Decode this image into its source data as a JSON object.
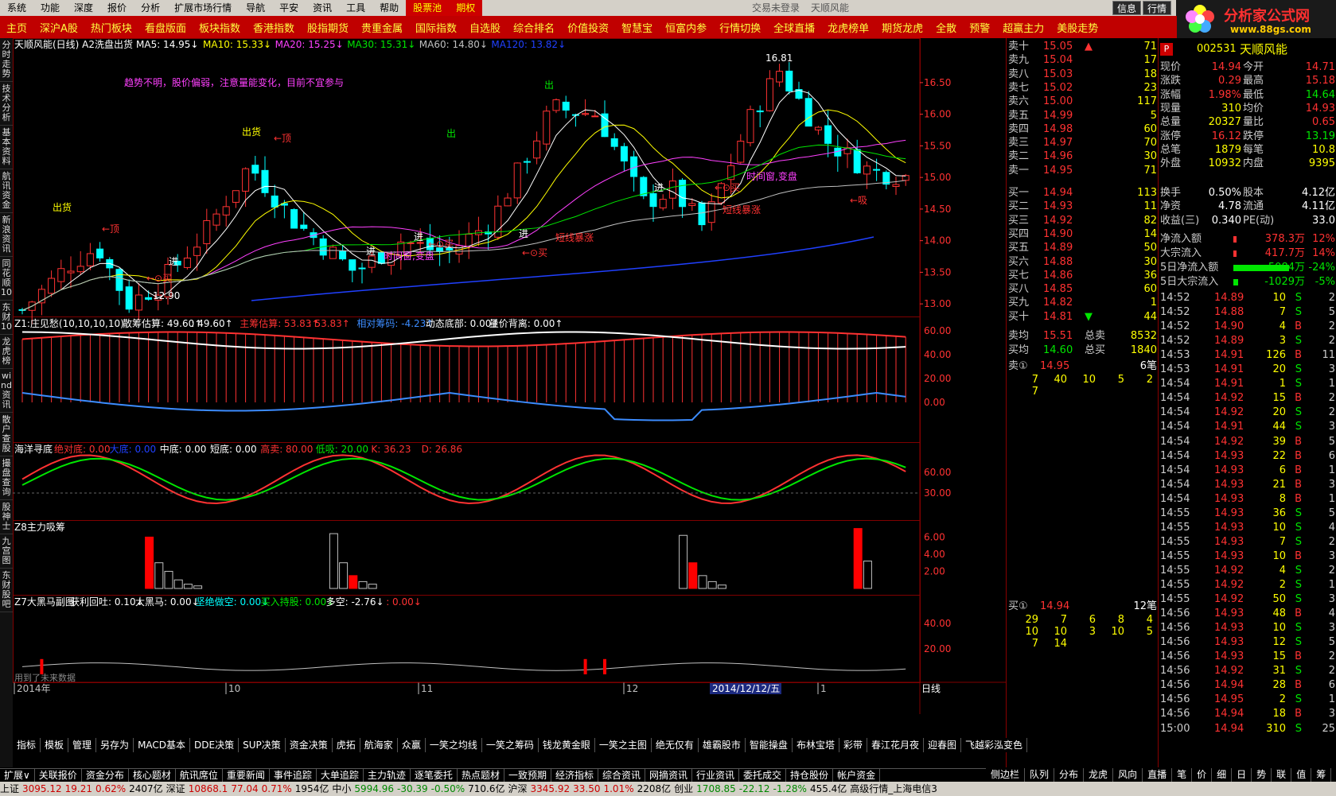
{
  "menu": {
    "items": [
      "系统",
      "功能",
      "深度",
      "报价",
      "分析",
      "扩展市场行情",
      "导航",
      "平安",
      "资讯",
      "工具",
      "帮助"
    ],
    "red_items": [
      "股票池",
      "期权"
    ],
    "center_text": "交易未登录",
    "center_name": "天顺风能",
    "right_buttons": [
      "信息",
      "行情"
    ]
  },
  "logo": {
    "title": "分析家公式网",
    "url": "www.88gs.com"
  },
  "toolbar": [
    "主页",
    "深沪A股",
    "热门板块",
    "看盘版面",
    "板块指数",
    "香港指数",
    "股指期货",
    "贵重金属",
    "国际指数",
    "自选股",
    "综合排名",
    "价值投资",
    "智慧宝",
    "恒富内参",
    "行情切换",
    "全球直播",
    "龙虎榜单",
    "期货龙虎",
    "全散",
    "预警",
    "超赢主力",
    "美股走势"
  ],
  "vtabs": [
    "分时走势",
    "技术分析",
    "基本资料",
    "航讯资金",
    "新浪资讯",
    "同花顺10",
    "东财10",
    "龙虎榜",
    "wind资讯",
    "散户查股",
    "撮盘查询",
    "股神士",
    "九宫图",
    "东财股吧"
  ],
  "main": {
    "title": "天顺风能(日线) A2洗盘出货",
    "ma": [
      {
        "label": "MA5: 14.95",
        "color": "#ffffff"
      },
      {
        "label": "MA10: 15.33",
        "color": "#ffff00"
      },
      {
        "label": "MA20: 15.25",
        "color": "#ff40ff"
      },
      {
        "label": "MA30: 15.31",
        "color": "#00e600"
      },
      {
        "label": "MA60: 14.80",
        "color": "#c0c0c0"
      },
      {
        "label": "MA120: 13.82",
        "color": "#2040ff"
      }
    ],
    "notice": "趋势不明，股价偏弱，注意量能变化，目前不宜参与",
    "high_label": "16.81",
    "low_label": "12.90",
    "annotations": [
      "出货",
      "←顶",
      "出货",
      "←顶",
      "出",
      "出",
      "←⊙买",
      "←⊙买",
      "←⊙买",
      "←⊙买",
      "进",
      "进",
      "进",
      "进",
      "进",
      "短线暴涨",
      "短线暴涨",
      "时间窗,变盘",
      "时间窗,变盘",
      "←吸"
    ],
    "axis": [
      "16.50",
      "16.00",
      "15.50",
      "15.00",
      "14.50",
      "14.00",
      "13.50",
      "13.00"
    ]
  },
  "p1": {
    "title": "Z1:庄见愁(10,10,10,10)",
    "items": [
      {
        "t": "散筹估算: 49.60",
        "c": "#ffffff"
      },
      {
        "t": ": 49.60",
        "c": "#ffffff"
      },
      {
        "t": "主筹估算: 53.83",
        "c": "#ff3232"
      },
      {
        "t": ": 53.83",
        "c": "#ff3232"
      },
      {
        "t": "相对筹码: -4.23",
        "c": "#3c8cff"
      },
      {
        "t": "动态底部: 0.00",
        "c": "#ffffff"
      },
      {
        "t": "量价背离: 0.00",
        "c": "#ffffff"
      }
    ],
    "axis": [
      "60.00",
      "40.00",
      "20.00",
      "0.00"
    ]
  },
  "p2": {
    "title": "海洋寻底",
    "items": [
      {
        "t": "绝对底: 0.00",
        "c": "#ff3232"
      },
      {
        "t": "大底: 0.00",
        "c": "#2040ff"
      },
      {
        "t": "中底: 0.00",
        "c": "#ffffff"
      },
      {
        "t": "短底: 0.00",
        "c": "#ffffff"
      },
      {
        "t": "高卖: 80.00",
        "c": "#ff3232"
      },
      {
        "t": "低吸: 20.00",
        "c": "#00e600"
      },
      {
        "t": "K: 36.23",
        "c": "#ff3232"
      },
      {
        "t": "D: 26.86",
        "c": "#ff3232"
      }
    ],
    "axis": [
      "60.00",
      "30.00"
    ]
  },
  "p3": {
    "title": "Z8主力吸筹",
    "axis": [
      "6.00",
      "4.00",
      "2.00"
    ]
  },
  "p4": {
    "title": "Z7大黑马副图",
    "items": [
      {
        "t": "获利回吐: 0.10",
        "c": "#ffffff"
      },
      {
        "t": "大黑马: 0.00",
        "c": "#ffffff"
      },
      {
        "t": "坚绝做空: 0.00",
        "c": "#00ffff"
      },
      {
        "t": "买入持股: 0.00",
        "c": "#00e600"
      },
      {
        "t": "多空: -2.76",
        "c": "#ffffff"
      },
      {
        "t": ": 0.00",
        "c": "#ff3232"
      }
    ],
    "axis": [
      "40.00",
      "20.00"
    ],
    "bottom_note": "用到了未来数据"
  },
  "xaxis": {
    "labels": [
      "2014年",
      "10",
      "11",
      "12",
      "1"
    ],
    "highlight": "2014/12/12/五",
    "right": "日线"
  },
  "bottom_tabs": [
    "指标",
    "模板",
    "管理",
    "另存为",
    "MACD基本",
    "DDE决策",
    "SUP决策",
    "资金决策",
    "虎拓",
    "航海家",
    "众赢",
    "一笑之均线",
    "一笑之筹码",
    "钱龙黄金眼",
    "一笑之主图",
    "绝无仅有",
    "雄霸股市",
    "智能操盘",
    "布林宝塔",
    "彩带",
    "春江花月夜",
    "迎春图",
    "飞越彩泓变色"
  ],
  "nav_tabs": [
    "扩展∨",
    "关联报价",
    "资金分布",
    "核心题材",
    "航讯席位",
    "重要新闻",
    "事件追踪",
    "大单追踪",
    "主力轨迹",
    "逐笔委托",
    "热点题材",
    "一致预期",
    "经济指标",
    "综合资讯",
    "网摘资讯",
    "行业资讯",
    "委托成交",
    "持仓股份",
    "帐户资金"
  ],
  "right_tabs": [
    "侧边栏",
    "队列",
    "分布",
    "龙虎",
    "风向",
    "直播",
    "笔",
    "价",
    "细",
    "日",
    "势",
    "联",
    "值",
    "筹"
  ],
  "status": [
    {
      "t": "上证",
      "c": "#000"
    },
    {
      "t": "3095.12",
      "c": "#c00"
    },
    {
      "t": "19.21",
      "c": "#c00"
    },
    {
      "t": "0.62%",
      "c": "#c00"
    },
    {
      "t": "2407亿",
      "c": "#000"
    },
    {
      "t": "深证",
      "c": "#000"
    },
    {
      "t": "10868.1",
      "c": "#c00"
    },
    {
      "t": "77.04",
      "c": "#c00"
    },
    {
      "t": "0.71%",
      "c": "#c00"
    },
    {
      "t": "1954亿",
      "c": "#000"
    },
    {
      "t": "中小",
      "c": "#000"
    },
    {
      "t": "5994.96",
      "c": "#080"
    },
    {
      "t": "-30.39",
      "c": "#080"
    },
    {
      "t": "-0.50%",
      "c": "#080"
    },
    {
      "t": "710.6亿",
      "c": "#000"
    },
    {
      "t": "沪深",
      "c": "#000"
    },
    {
      "t": "3345.92",
      "c": "#c00"
    },
    {
      "t": "33.50",
      "c": "#c00"
    },
    {
      "t": "1.01%",
      "c": "#c00"
    },
    {
      "t": "2208亿",
      "c": "#000"
    },
    {
      "t": "创业",
      "c": "#000"
    },
    {
      "t": "1708.85",
      "c": "#080"
    },
    {
      "t": "-22.12",
      "c": "#080"
    },
    {
      "t": "-1.28%",
      "c": "#080"
    },
    {
      "t": "455.4亿",
      "c": "#000"
    },
    {
      "t": "高级行情_上海电信3",
      "c": "#000"
    }
  ],
  "orderbook": {
    "sells": [
      {
        "n": "卖十",
        "p": "15.05",
        "v": "71",
        "mark": "▲"
      },
      {
        "n": "卖九",
        "p": "15.04",
        "v": "17"
      },
      {
        "n": "卖八",
        "p": "15.03",
        "v": "18"
      },
      {
        "n": "卖七",
        "p": "15.02",
        "v": "23"
      },
      {
        "n": "卖六",
        "p": "15.00",
        "v": "117"
      },
      {
        "n": "卖五",
        "p": "14.99",
        "v": "5"
      },
      {
        "n": "卖四",
        "p": "14.98",
        "v": "60"
      },
      {
        "n": "卖三",
        "p": "14.97",
        "v": "70"
      },
      {
        "n": "卖二",
        "p": "14.96",
        "v": "30"
      },
      {
        "n": "卖一",
        "p": "14.95",
        "v": "71"
      }
    ],
    "buys": [
      {
        "n": "买一",
        "p": "14.94",
        "v": "113"
      },
      {
        "n": "买二",
        "p": "14.93",
        "v": "11"
      },
      {
        "n": "买三",
        "p": "14.92",
        "v": "82"
      },
      {
        "n": "买四",
        "p": "14.90",
        "v": "14"
      },
      {
        "n": "买五",
        "p": "14.89",
        "v": "50"
      },
      {
        "n": "买六",
        "p": "14.88",
        "v": "30"
      },
      {
        "n": "买七",
        "p": "14.86",
        "v": "36"
      },
      {
        "n": "买八",
        "p": "14.85",
        "v": "60"
      },
      {
        "n": "买九",
        "p": "14.82",
        "v": "1"
      },
      {
        "n": "买十",
        "p": "14.81",
        "v": "44",
        "mark": "▼"
      }
    ],
    "avg_sell": {
      "n": "卖均",
      "p": "15.51",
      "tn": "总卖",
      "tv": "8532"
    },
    "avg_buy": {
      "n": "买均",
      "p": "14.60",
      "tn": "总买",
      "tv": "1840"
    },
    "queue_sell": {
      "n": "卖①",
      "p": "14.95",
      "cnt": "6笔",
      "rows": [
        [
          "7",
          "40",
          "10",
          "5",
          "2"
        ],
        [
          "7"
        ]
      ]
    },
    "queue_buy": {
      "n": "买①",
      "p": "14.94",
      "cnt": "12笔",
      "rows": [
        [
          "29",
          "7",
          "6",
          "8",
          "4"
        ],
        [
          "10",
          "10",
          "3",
          "10",
          "5"
        ],
        [
          "7",
          "14"
        ]
      ]
    }
  },
  "quote": {
    "badge": "P",
    "code": "002531",
    "name": "天顺风能",
    "rows": [
      [
        "现价",
        "14.94",
        "今开",
        "14.71"
      ],
      [
        "涨跌",
        "0.29",
        "最高",
        "15.18"
      ],
      [
        "涨幅",
        "1.98%",
        "最低",
        "14.64"
      ],
      [
        "现量",
        "310",
        "均价",
        "14.93"
      ],
      [
        "总量",
        "20327",
        "量比",
        "0.65"
      ],
      [
        "涨停",
        "16.12",
        "跌停",
        "13.19"
      ],
      [
        "总笔",
        "1879",
        "每笔",
        "10.8"
      ],
      [
        "外盘",
        "10932",
        "内盘",
        "9395"
      ]
    ],
    "rows2": [
      [
        "换手",
        "0.50%",
        "股本",
        "4.12亿"
      ],
      [
        "净资",
        "4.78",
        "流通",
        "4.11亿"
      ],
      [
        "收益(三)",
        "0.340",
        "PE(动)",
        "33.0"
      ]
    ],
    "flows": [
      {
        "n": "净流入额",
        "v": "378.3万",
        "p": "12%"
      },
      {
        "n": "大宗流入",
        "v": "417.7万",
        "p": "14%"
      },
      {
        "n": "5日净流入额",
        "v": "-5084万",
        "p": "-24%"
      },
      {
        "n": "5日大宗流入",
        "v": "-1029万",
        "p": "-5%"
      }
    ]
  },
  "ticks": [
    [
      "14:52",
      "14.89",
      "10",
      "S",
      "2"
    ],
    [
      "14:52",
      "14.88",
      "7",
      "S",
      "5"
    ],
    [
      "14:52",
      "14.90",
      "4",
      "B",
      "2"
    ],
    [
      "14:52",
      "14.89",
      "3",
      "S",
      "2"
    ],
    [
      "14:53",
      "14.91",
      "126",
      "B",
      "11"
    ],
    [
      "14:53",
      "14.91",
      "20",
      "S",
      "3"
    ],
    [
      "14:54",
      "14.91",
      "1",
      "S",
      "1"
    ],
    [
      "14:54",
      "14.92",
      "15",
      "B",
      "2"
    ],
    [
      "14:54",
      "14.92",
      "20",
      "S",
      "2"
    ],
    [
      "14:54",
      "14.91",
      "44",
      "S",
      "3"
    ],
    [
      "14:54",
      "14.92",
      "39",
      "B",
      "5"
    ],
    [
      "14:54",
      "14.93",
      "22",
      "B",
      "6"
    ],
    [
      "14:54",
      "14.93",
      "6",
      "B",
      "1"
    ],
    [
      "14:54",
      "14.93",
      "21",
      "B",
      "3"
    ],
    [
      "14:54",
      "14.93",
      "8",
      "B",
      "1"
    ],
    [
      "14:55",
      "14.93",
      "36",
      "S",
      "5"
    ],
    [
      "14:55",
      "14.93",
      "10",
      "S",
      "4"
    ],
    [
      "14:55",
      "14.93",
      "7",
      "S",
      "2"
    ],
    [
      "14:55",
      "14.93",
      "10",
      "B",
      "3"
    ],
    [
      "14:55",
      "14.92",
      "4",
      "S",
      "2"
    ],
    [
      "14:55",
      "14.92",
      "2",
      "S",
      "1"
    ],
    [
      "14:55",
      "14.92",
      "50",
      "S",
      "3"
    ],
    [
      "14:56",
      "14.93",
      "48",
      "B",
      "4"
    ],
    [
      "14:56",
      "14.93",
      "10",
      "S",
      "3"
    ],
    [
      "14:56",
      "14.93",
      "12",
      "S",
      "5"
    ],
    [
      "14:56",
      "14.93",
      "15",
      "B",
      "2"
    ],
    [
      "14:56",
      "14.92",
      "31",
      "S",
      "2"
    ],
    [
      "14:56",
      "14.94",
      "28",
      "B",
      "6"
    ],
    [
      "14:56",
      "14.95",
      "2",
      "S",
      "1"
    ],
    [
      "14:56",
      "14.94",
      "18",
      "B",
      "3"
    ],
    [
      "15:00",
      "14.94",
      "310",
      "S",
      "25"
    ]
  ],
  "colors": {
    "up": "#ff3232",
    "down": "#00ffff",
    "ma5": "#ffffff",
    "ma10": "#ffff00",
    "ma20": "#ff40ff",
    "ma30": "#00e600",
    "ma60": "#c0c0c0",
    "ma120": "#2040ff",
    "grid": "#800000"
  }
}
